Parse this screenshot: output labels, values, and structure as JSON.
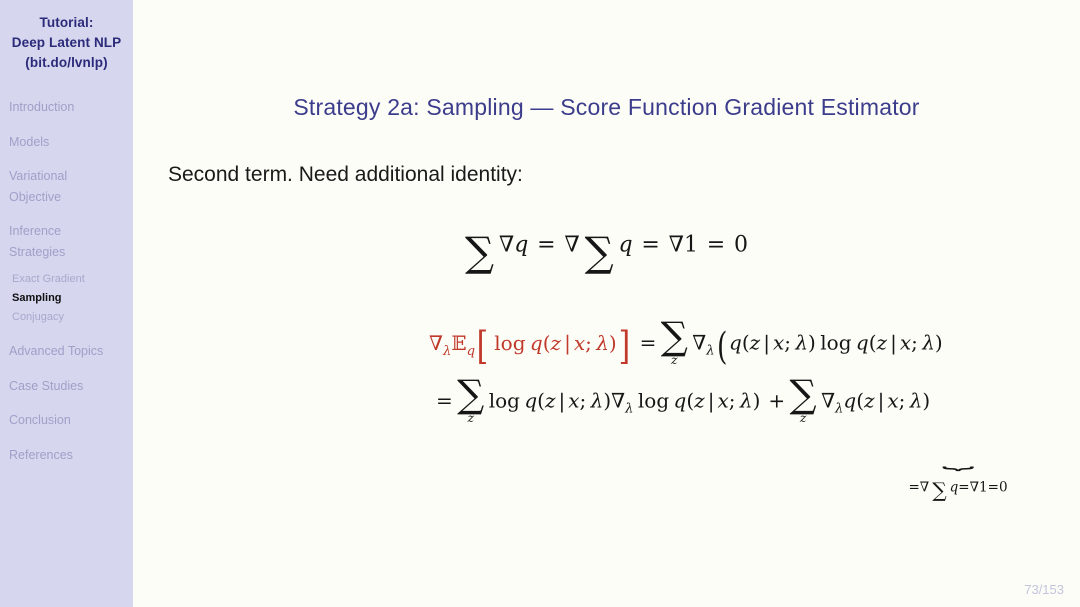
{
  "sidebar": {
    "title_lines": [
      "Tutorial:",
      "Deep Latent NLP",
      "(bit.do/lvnlp)"
    ],
    "items": [
      {
        "label": "Introduction",
        "lines": [
          "Introduction"
        ],
        "active": false,
        "level": 1
      },
      {
        "label": "Models",
        "lines": [
          "Models"
        ],
        "active": false,
        "level": 1
      },
      {
        "label": "Variational Objective",
        "lines": [
          "Variational",
          "Objective"
        ],
        "active": false,
        "level": 1
      },
      {
        "label": "Inference Strategies",
        "lines": [
          "Inference",
          "Strategies"
        ],
        "active": false,
        "level": 1
      },
      {
        "label": "Exact Gradient",
        "lines": [
          "Exact Gradient"
        ],
        "active": false,
        "level": 2
      },
      {
        "label": "Sampling",
        "lines": [
          "Sampling"
        ],
        "active": true,
        "level": 2
      },
      {
        "label": "Conjugacy",
        "lines": [
          "Conjugacy"
        ],
        "active": false,
        "level": 2
      },
      {
        "label": "Advanced Topics",
        "lines": [
          "Advanced Topics"
        ],
        "active": false,
        "level": 1
      },
      {
        "label": "Case Studies",
        "lines": [
          "Case Studies"
        ],
        "active": false,
        "level": 1
      },
      {
        "label": "Conclusion",
        "lines": [
          "Conclusion"
        ],
        "active": false,
        "level": 1
      },
      {
        "label": "References",
        "lines": [
          "References"
        ],
        "active": false,
        "level": 1
      }
    ]
  },
  "slide": {
    "title": "Strategy 2a: Sampling — Score Function Gradient Estimator",
    "body_text": "Second term. Need additional identity:",
    "page_number": "73/153",
    "equation_identity": "∑ ∇q = ∇ ∑ q = ∇1 = 0",
    "equation_line1": "∇λ Eq[ log q(z | x; λ) ] = ∑z ∇λ( q(z | x; λ) log q(z | x; λ)",
    "equation_line2": "= ∑z log q(z | x; λ) ∇λ log q(z | x; λ) + ∑z ∇λ q(z | x; λ)",
    "underbrace_label": "=∇ ∑ q=∇1=0"
  },
  "colors": {
    "sidebar_bg": "#d6d6ef",
    "sidebar_title": "#2b2b7a",
    "sidebar_item": "#a0a0c8",
    "sidebar_active": "#101010",
    "slide_title": "#3c3c8c",
    "highlight_red": "#c0392b",
    "page_number": "#c3c3dd",
    "background": "#fdfdf7"
  }
}
